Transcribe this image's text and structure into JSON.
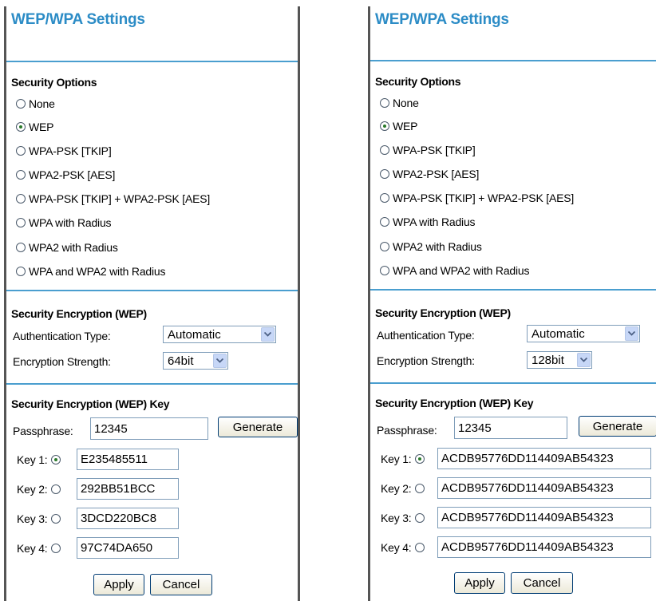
{
  "panels": [
    {
      "title": "WEP/WPA Settings",
      "security_options": {
        "heading": "Security Options",
        "options": [
          "None",
          "WEP",
          "WPA-PSK [TKIP]",
          "WPA2-PSK [AES]",
          "WPA-PSK [TKIP] + WPA2-PSK [AES]",
          "WPA with Radius",
          "WPA2 with Radius",
          "WPA and WPA2 with Radius"
        ],
        "selected": "WEP"
      },
      "encryption": {
        "heading": "Security Encryption (WEP)",
        "auth_label": "Authentication Type:",
        "auth_value": "Automatic",
        "strength_label": "Encryption Strength:",
        "strength_value": "64bit"
      },
      "key_section": {
        "heading": "Security Encryption (WEP) Key",
        "passphrase_label": "Passphrase:",
        "passphrase_value": "12345",
        "generate_label": "Generate",
        "keys": [
          {
            "label": "Key 1:",
            "value": "E235485511",
            "selected": true
          },
          {
            "label": "Key 2:",
            "value": "292BB51BCC",
            "selected": false
          },
          {
            "label": "Key 3:",
            "value": "3DCD220BC8",
            "selected": false
          },
          {
            "label": "Key 4:",
            "value": "97C74DA650",
            "selected": false
          }
        ]
      },
      "apply_label": "Apply",
      "cancel_label": "Cancel"
    },
    {
      "title": "WEP/WPA Settings",
      "security_options": {
        "heading": "Security Options",
        "options": [
          "None",
          "WEP",
          "WPA-PSK [TKIP]",
          "WPA2-PSK [AES]",
          "WPA-PSK [TKIP] + WPA2-PSK [AES]",
          "WPA with Radius",
          "WPA2 with Radius",
          "WPA and WPA2 with Radius"
        ],
        "selected": "WEP"
      },
      "encryption": {
        "heading": "Security Encryption (WEP)",
        "auth_label": "Authentication Type:",
        "auth_value": "Automatic",
        "strength_label": "Encryption Strength:",
        "strength_value": "128bit"
      },
      "key_section": {
        "heading": "Security Encryption (WEP) Key",
        "passphrase_label": "Passphrase:",
        "passphrase_value": "12345",
        "generate_label": "Generate",
        "keys": [
          {
            "label": "Key 1:",
            "value": "ACDB95776DD114409AB54323",
            "selected": true
          },
          {
            "label": "Key 2:",
            "value": "ACDB95776DD114409AB54323",
            "selected": false
          },
          {
            "label": "Key 3:",
            "value": "ACDB95776DD114409AB54323",
            "selected": false
          },
          {
            "label": "Key 4:",
            "value": "ACDB95776DD114409AB54323",
            "selected": false
          }
        ]
      },
      "apply_label": "Apply",
      "cancel_label": "Cancel"
    }
  ]
}
